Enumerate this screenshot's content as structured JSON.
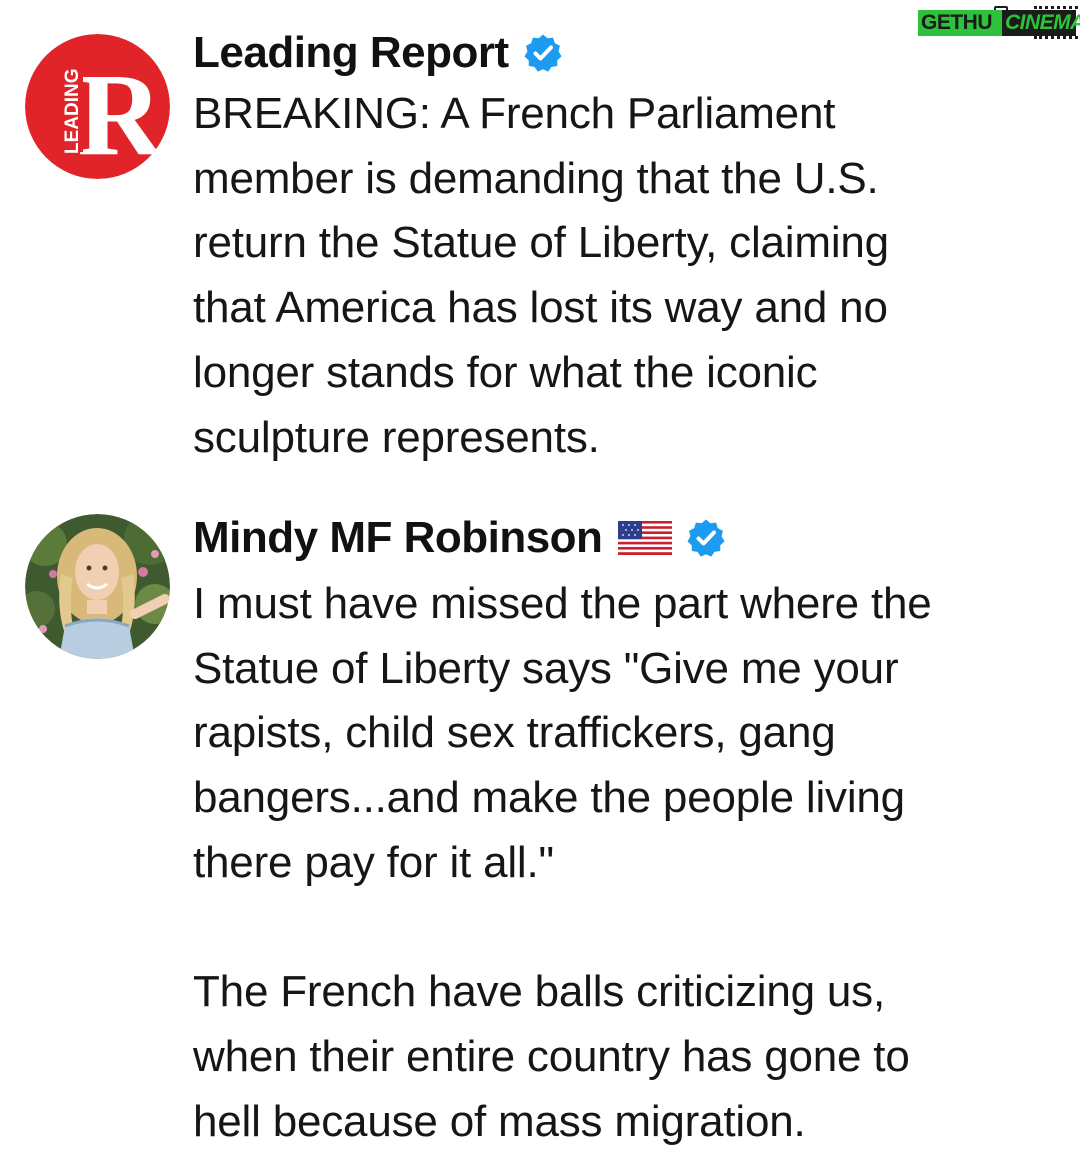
{
  "watermark": {
    "part1": "GETHU",
    "part2": "CINEMA"
  },
  "posts": [
    {
      "author": "Leading Report",
      "verified": true,
      "avatar": "leading-report-logo",
      "avatar_text": "LEADING",
      "avatar_letter": "R",
      "body": "BREAKING: A French Parliament\nmember is demanding that the U.S.\nreturn the Statue of Liberty, claiming\nthat America has lost its way and no\nlonger stands for what the iconic\nsculpture represents."
    },
    {
      "author": "Mindy MF Robinson",
      "flag": "us-flag-icon",
      "verified": true,
      "avatar": "profile-photo",
      "body": "I must have missed the part where the\nStatue of Liberty says \"Give me your\nrapists, child sex traffickers, gang\nbangers...and make the people living\nthere pay for it all.\"\n\nThe French have balls criticizing us,\nwhen their entire country has gone to\nhell because of mass migration."
    }
  ],
  "colors": {
    "verified_blue": "#1d9bf0",
    "leading_red": "#e0242a",
    "text": "#111111",
    "watermark_green": "#2cc23a"
  }
}
